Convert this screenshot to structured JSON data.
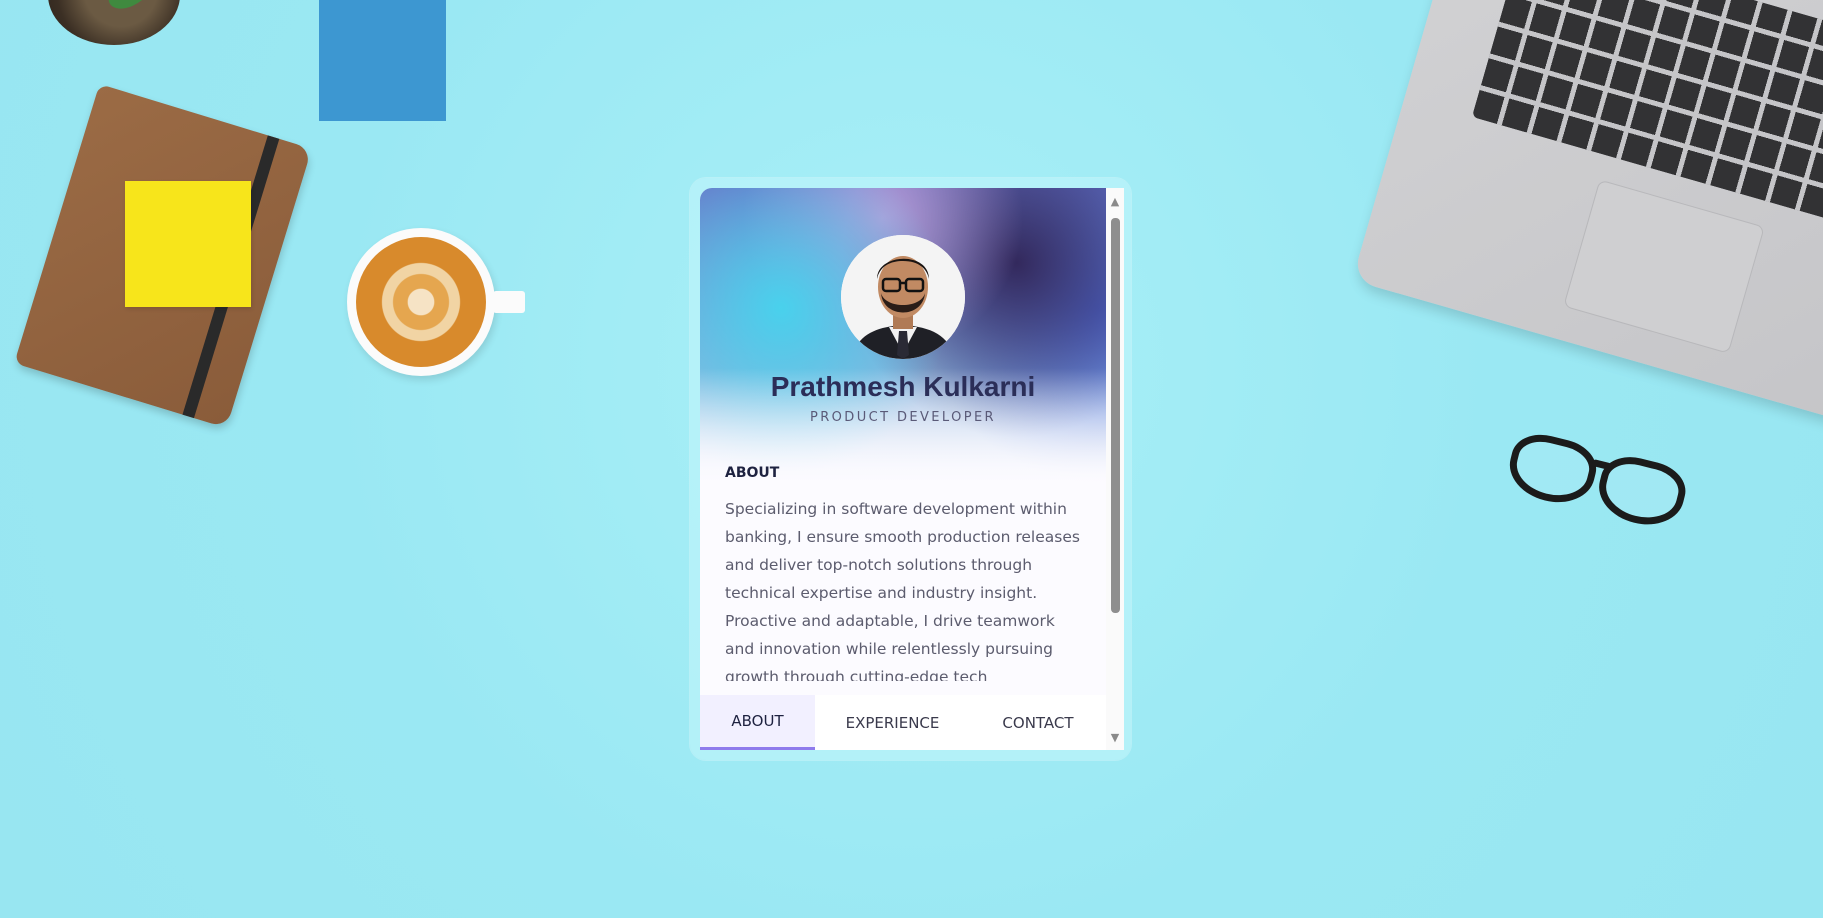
{
  "profile": {
    "name": "Prathmesh Kulkarni",
    "role": "PRODUCT DEVELOPER",
    "avatar_icon": "profile-photo"
  },
  "about": {
    "heading": "ABOUT",
    "text": "Specializing in software development within banking, I ensure smooth production releases and deliver top-notch solutions through technical expertise and industry insight. Proactive and adaptable, I drive teamwork and innovation while relentlessly pursuing growth through cutting-edge tech"
  },
  "tabs": [
    {
      "label": "ABOUT",
      "active": true
    },
    {
      "label": "EXPERIENCE",
      "active": false
    },
    {
      "label": "CONTACT",
      "active": false
    }
  ],
  "scrollbar": {
    "up_icon": "▲",
    "down_icon": "▼"
  },
  "colors": {
    "background": "#a0ecf4",
    "accent": "#8f7bec",
    "name_text": "#2b2e58"
  }
}
